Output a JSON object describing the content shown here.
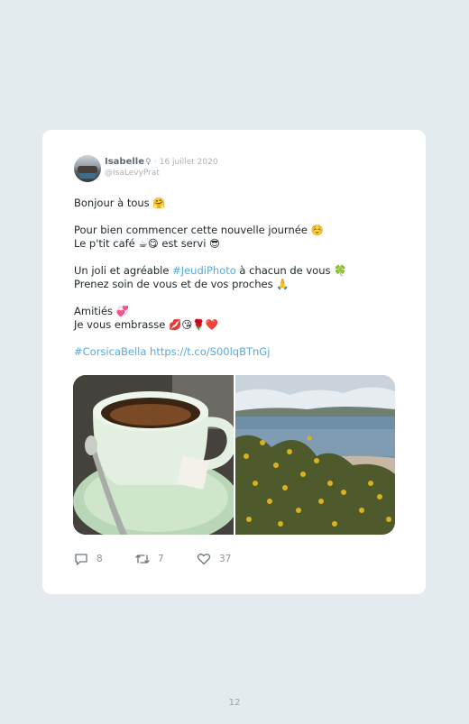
{
  "tweet": {
    "author_name": "Isabelle",
    "verified_glyph": "♀",
    "date": "· 16 juillet 2020",
    "handle": "@IsaLevyPrat",
    "lines": {
      "l1": "Bonjour à tous 🤗",
      "l2": "Pour bien commencer cette nouvelle journée ☺️",
      "l3": "Le p'tit café ☕😋 est servi 😎",
      "l4a": "Un joli et agréable ",
      "l4b": "#JeudiPhoto",
      "l4c": " à chacun de vous 🍀",
      "l5": "Prenez soin de vous et de vos proches 🙏",
      "l6": "Amitiés 💞",
      "l7": "Je vous embrasse 💋😘🌹❤️",
      "l8a": "#CorsicaBella",
      "l8b": " https://t.co/S00lqBTnGj"
    },
    "media": [
      "coffee-cup-photo",
      "seaside-flowers-photo"
    ],
    "stats": {
      "replies": "8",
      "retweets": "7",
      "likes": "37"
    },
    "colors": {
      "link": "#58a9dc",
      "card_bg": "#ffffff",
      "page_bg": "#e4ebee"
    }
  },
  "page": {
    "number": "12"
  }
}
